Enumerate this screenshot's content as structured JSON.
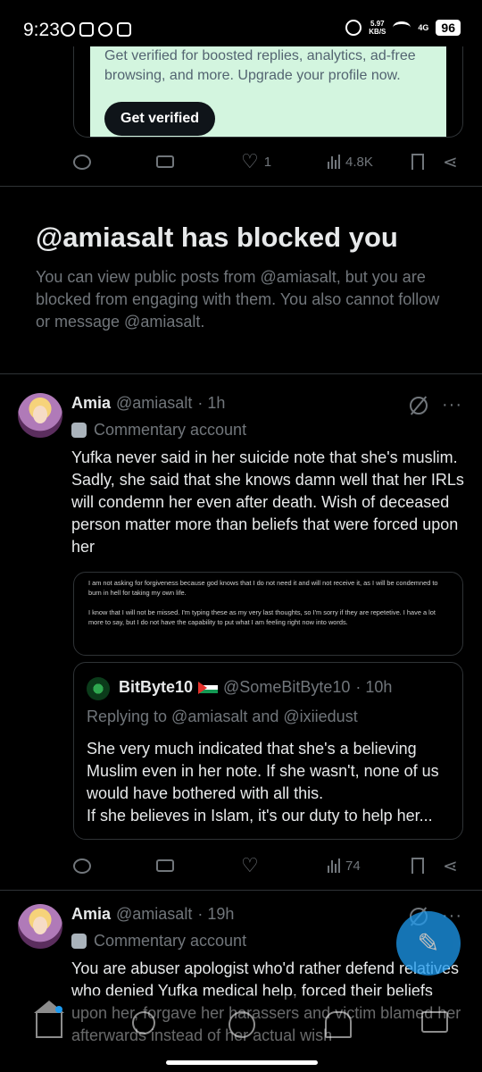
{
  "status_bar": {
    "time": "9:23",
    "net_speed_value": "5.97",
    "net_speed_unit": "KB/S",
    "signal": "4G",
    "battery": "96"
  },
  "promo": {
    "text": "Get verified for boosted replies, analytics, ad-free browsing, and more. Upgrade your profile now.",
    "button": "Get verified"
  },
  "top_actions": {
    "likes": "1",
    "views": "4.8K"
  },
  "blocked": {
    "title": "@amiasalt has blocked you",
    "description": "You can view public posts from @amiasalt, but you are blocked from engaging with them. You also cannot follow or message @amiasalt."
  },
  "tweet1": {
    "name": "Amia",
    "handle": "@amiasalt",
    "time": "· 1h",
    "label": "Commentary account",
    "text": "Yufka never said in her suicide note that she's muslim. Sadly, she said that she knows damn well that her IRLs will condemn her even after death. Wish of deceased person matter more than beliefs that were forced upon her",
    "image_text_1": "I am not asking for forgiveness because god knows that I do not need it and will not receive it, as I will be condemned to burn in hell for taking my own life.",
    "image_text_2": "I know that I will not be missed. I'm typing these as my very last thoughts, so I'm sorry if they are repetetive. I have a lot more to say, but I do not have the capability to put what I am feeling right now into words.",
    "quote": {
      "name": "BitByte10",
      "handle": "@SomeBitByte10",
      "time": "· 10h",
      "replying": "Replying to @amiasalt and @ixiiedust",
      "text": "She very much indicated that she's a believing Muslim even in her note. If she wasn't, none of us would have bothered with all this.\nIf she believes in Islam, it's our duty to help her..."
    },
    "views": "74"
  },
  "tweet2": {
    "name": "Amia",
    "handle": "@amiasalt",
    "time": "· 19h",
    "label": "Commentary account",
    "text": "You are abuser apologist who'd rather defend relatives who denied Yufka medical help, forced their beliefs upon her, forgave her harassers and victim blamed her afterwards instead of her actual wish"
  },
  "icons": {
    "reply": "reply-icon",
    "repost": "repost-icon",
    "like": "heart-icon",
    "views": "views-icon",
    "bookmark": "bookmark-icon",
    "share": "share-icon"
  },
  "colors": {
    "accent": "#1d9bf0",
    "promo_bg": "#d3f5df",
    "muted": "#71767b"
  }
}
